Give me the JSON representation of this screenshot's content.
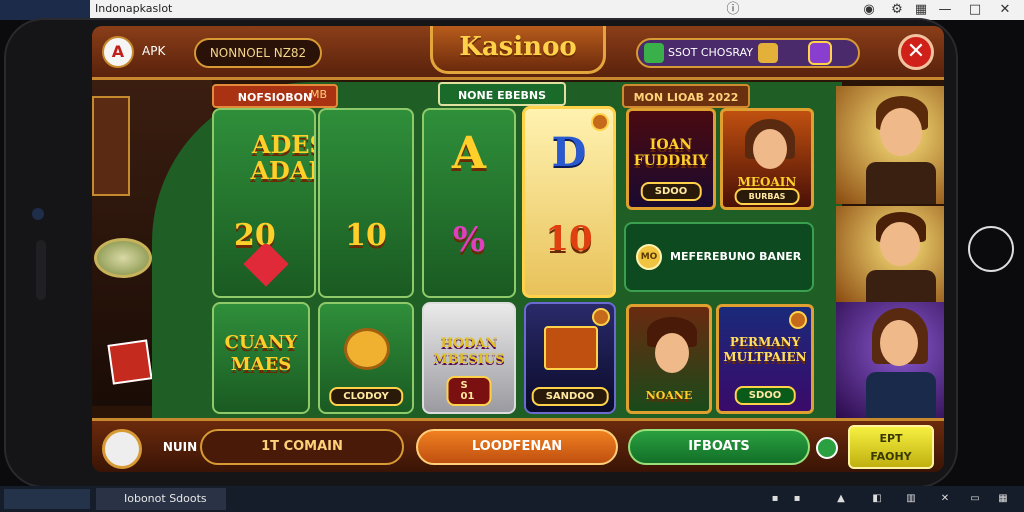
{
  "window": {
    "title": "Indonapkaslot",
    "controls": [
      "—",
      "□",
      "✕"
    ]
  },
  "game": {
    "logo_letter": "A",
    "apk_label": "APK",
    "balance_pill": "NONNOEL NZ82",
    "brand": "Kasinoo",
    "shop_text": "SSOT CHOSRAY",
    "close_symbol": "✕",
    "sections": {
      "left": "NOFSIOBON",
      "left_count": "MB",
      "middle": "NONE EBEBNS",
      "right": "MON LIOAB 2022"
    },
    "tiles": [
      {
        "title": "ADESNS ADADOS",
        "value": "20"
      },
      {
        "value": "10"
      },
      {
        "title": "A",
        "value": "%"
      },
      {
        "title": "D",
        "value": "10"
      }
    ],
    "lower_tiles": [
      {
        "title": "CUANY MAES"
      },
      {
        "tag": "CLODOY"
      },
      {
        "title": "HODAN MBESIUS",
        "tag": "S 01"
      },
      {
        "tag": "SANDOO"
      }
    ],
    "portraits": [
      {
        "title": "IOAN FUDDRIY",
        "tag": "SDOO"
      },
      {
        "title": "MEOAIN",
        "tag": "BURBAS"
      },
      {
        "title": "NOANE",
        "tag": ""
      },
      {
        "title": "PERMANY MULTPAIEN",
        "tag": "SDOO"
      }
    ],
    "banner": {
      "coin": "MO",
      "text": "MEFEREBUNO BANER"
    },
    "bottom": {
      "main": "NUIN",
      "btn1": "1T COMAIN",
      "btn2": "LOODFENAN",
      "btn3": "IFBOATS",
      "btn4_line1": "EPT",
      "btn4_line2": "FAOHY"
    }
  },
  "taskbar": {
    "app_label": "Iobonot Sdoots"
  }
}
